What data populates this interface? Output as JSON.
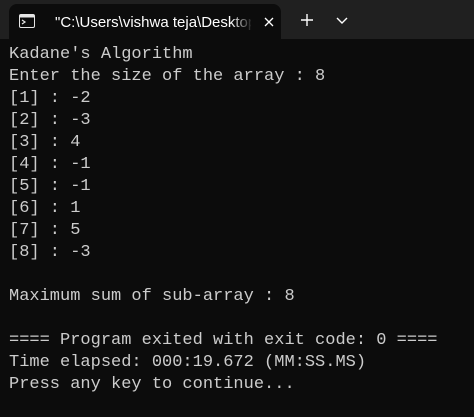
{
  "window": {
    "tab_title": "\"C:\\Users\\vishwa teja\\Desktop\\"
  },
  "icons": {
    "tab": "console-icon",
    "close": "close-icon",
    "new_tab": "plus-icon",
    "dropdown": "chevron-down-icon"
  },
  "colors": {
    "background": "#0c0c0c",
    "titlebar": "#202020",
    "text": "#cccccc"
  },
  "console": {
    "lines": [
      "Kadane's Algorithm",
      "Enter the size of the array : 8",
      "[1] : -2",
      "[2] : -3",
      "[3] : 4",
      "[4] : -1",
      "[5] : -1",
      "[6] : 1",
      "[7] : 5",
      "[8] : -3",
      "",
      "Maximum sum of sub-array : 8",
      "",
      "==== Program exited with exit code: 0 ====",
      "Time elapsed: 000:19.672 (MM:SS.MS)",
      "Press any key to continue..."
    ]
  }
}
